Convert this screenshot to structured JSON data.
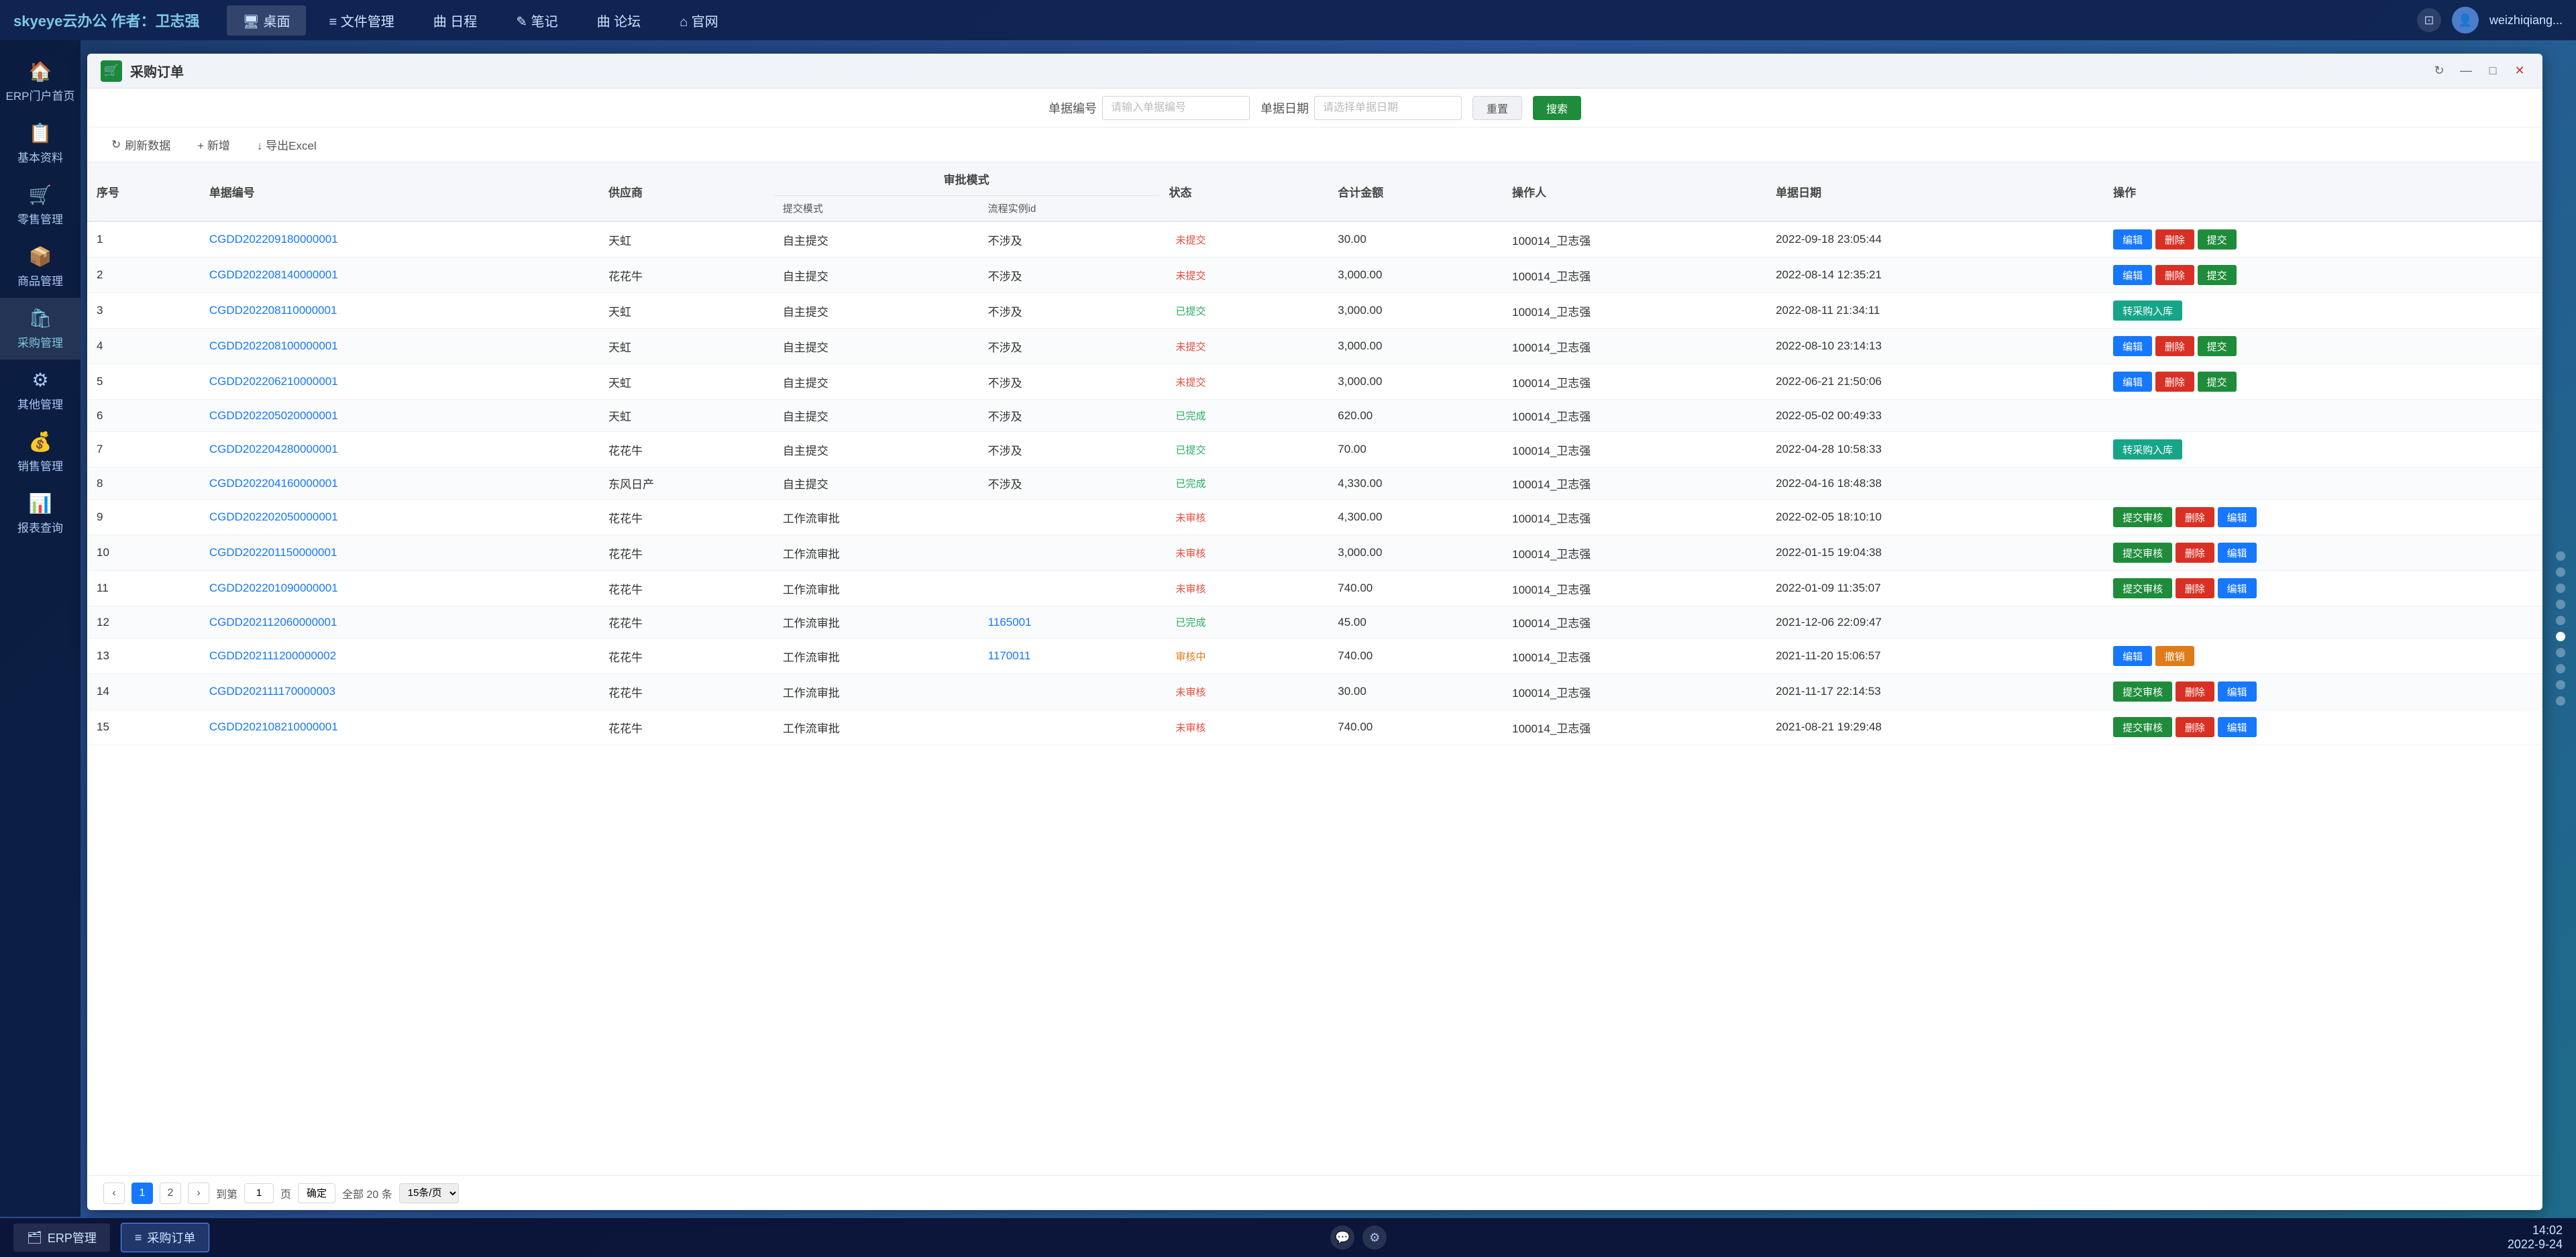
{
  "app": {
    "brand": "skyeye云办公 作者：卫志强",
    "nav_items": [
      {
        "label": "🖥 桌面",
        "active": true
      },
      {
        "label": "≡ 文件管理",
        "active": false
      },
      {
        "label": "曲 日程",
        "active": false
      },
      {
        "label": "✎ 笔记",
        "active": false
      },
      {
        "label": "曲 论坛",
        "active": false
      },
      {
        "label": "⌂ 官网",
        "active": false
      }
    ],
    "user": "weizhiqiang...",
    "time": "14:02\n2022-9-24"
  },
  "sidebar": {
    "items": [
      {
        "label": "ERP门户首页",
        "icon": "🏠"
      },
      {
        "label": "基本资料",
        "icon": "📋"
      },
      {
        "label": "零售管理",
        "icon": "🛒"
      },
      {
        "label": "商品管理",
        "icon": "📦"
      },
      {
        "label": "采购管理",
        "icon": "🛍",
        "active": true
      },
      {
        "label": "其他管理",
        "icon": "⚙"
      },
      {
        "label": "销售管理",
        "icon": "💰"
      },
      {
        "label": "报表查询",
        "icon": "📊"
      }
    ]
  },
  "window": {
    "title": "采购订单",
    "title_icon": "🛒"
  },
  "search": {
    "order_no_label": "单据编号",
    "order_no_placeholder": "请输入单据编号",
    "order_date_label": "单据日期",
    "order_date_placeholder": "请选择单据日期",
    "reset_label": "重置",
    "search_label": "搜索"
  },
  "actions": {
    "refresh": "刷新数据",
    "add": "+ 新增",
    "export": "↓ 导出Excel"
  },
  "table": {
    "columns": {
      "seq": "序号",
      "order_no": "单据编号",
      "supplier": "供应商",
      "approval_mode": "审批模式",
      "submit_mode": "提交模式",
      "process_id": "流程实例id",
      "status": "状态",
      "total_amount": "合计金额",
      "operator": "操作人",
      "order_date": "单据日期",
      "actions": "操作"
    },
    "rows": [
      {
        "seq": 1,
        "order_no": "CGDD202209180000001",
        "supplier": "天虹",
        "submit_mode": "自主提交",
        "process_id": "不涉及",
        "status": "未提交",
        "status_type": "red",
        "total_amount": "30.00",
        "operator": "100014_卫志强",
        "order_date": "2022-09-18 23:05:44",
        "btns": [
          "编辑",
          "删除",
          "提交"
        ]
      },
      {
        "seq": 2,
        "order_no": "CGDD202208140000001",
        "supplier": "花花牛",
        "submit_mode": "自主提交",
        "process_id": "不涉及",
        "status": "未提交",
        "status_type": "red",
        "total_amount": "3,000.00",
        "operator": "100014_卫志强",
        "order_date": "2022-08-14 12:35:21",
        "btns": [
          "编辑",
          "删除",
          "提交"
        ]
      },
      {
        "seq": 3,
        "order_no": "CGDD202208110000001",
        "supplier": "天虹",
        "submit_mode": "自主提交",
        "process_id": "不涉及",
        "status": "已提交",
        "status_type": "green",
        "total_amount": "3,000.00",
        "operator": "100014_卫志强",
        "order_date": "2022-08-11 21:34:11",
        "btns": [
          "转采购入库"
        ]
      },
      {
        "seq": 4,
        "order_no": "CGDD202208100000001",
        "supplier": "天虹",
        "submit_mode": "自主提交",
        "process_id": "不涉及",
        "status": "未提交",
        "status_type": "red",
        "total_amount": "3,000.00",
        "operator": "100014_卫志强",
        "order_date": "2022-08-10 23:14:13",
        "btns": [
          "编辑",
          "删除",
          "提交"
        ]
      },
      {
        "seq": 5,
        "order_no": "CGDD202206210000001",
        "supplier": "天虹",
        "submit_mode": "自主提交",
        "process_id": "不涉及",
        "status": "未提交",
        "status_type": "red",
        "total_amount": "3,000.00",
        "operator": "100014_卫志强",
        "order_date": "2022-06-21 21:50:06",
        "btns": [
          "编辑",
          "删除",
          "提交"
        ]
      },
      {
        "seq": 6,
        "order_no": "CGDD202205020000001",
        "supplier": "天虹",
        "submit_mode": "自主提交",
        "process_id": "不涉及",
        "status": "已完成",
        "status_type": "green",
        "total_amount": "620.00",
        "operator": "100014_卫志强",
        "order_date": "2022-05-02 00:49:33",
        "btns": []
      },
      {
        "seq": 7,
        "order_no": "CGDD202204280000001",
        "supplier": "花花牛",
        "submit_mode": "自主提交",
        "process_id": "不涉及",
        "status": "已提交",
        "status_type": "green",
        "total_amount": "70.00",
        "operator": "100014_卫志强",
        "order_date": "2022-04-28 10:58:33",
        "btns": [
          "转采购入库"
        ]
      },
      {
        "seq": 8,
        "order_no": "CGDD202204160000001",
        "supplier": "东风日产",
        "submit_mode": "自主提交",
        "process_id": "不涉及",
        "status": "已完成",
        "status_type": "green",
        "total_amount": "4,330.00",
        "operator": "100014_卫志强",
        "order_date": "2022-04-16 18:48:38",
        "btns": []
      },
      {
        "seq": 9,
        "order_no": "CGDD202202050000001",
        "supplier": "花花牛",
        "submit_mode": "工作流审批",
        "process_id": "",
        "status": "未审核",
        "status_type": "red",
        "total_amount": "4,300.00",
        "operator": "100014_卫志强",
        "order_date": "2022-02-05 18:10:10",
        "btns": [
          "提交审核",
          "删除",
          "编辑"
        ]
      },
      {
        "seq": 10,
        "order_no": "CGDD202201150000001",
        "supplier": "花花牛",
        "submit_mode": "工作流审批",
        "process_id": "",
        "status": "未审核",
        "status_type": "red",
        "total_amount": "3,000.00",
        "operator": "100014_卫志强",
        "order_date": "2022-01-15 19:04:38",
        "btns": [
          "提交审核",
          "删除",
          "编辑"
        ]
      },
      {
        "seq": 11,
        "order_no": "CGDD202201090000001",
        "supplier": "花花牛",
        "submit_mode": "工作流审批",
        "process_id": "",
        "status": "未审核",
        "status_type": "red",
        "total_amount": "740.00",
        "operator": "100014_卫志强",
        "order_date": "2022-01-09 11:35:07",
        "btns": [
          "提交审核",
          "删除",
          "编辑"
        ]
      },
      {
        "seq": 12,
        "order_no": "CGDD202112060000001",
        "supplier": "花花牛",
        "submit_mode": "工作流审批",
        "process_id": "1165001",
        "process_id_link": true,
        "status": "已完成",
        "status_type": "green",
        "total_amount": "45.00",
        "operator": "100014_卫志强",
        "order_date": "2021-12-06 22:09:47",
        "btns": []
      },
      {
        "seq": 13,
        "order_no": "CGDD202111200000002",
        "supplier": "花花牛",
        "submit_mode": "工作流审批",
        "process_id": "1170011",
        "process_id_link": true,
        "status": "审核中",
        "status_type": "orange",
        "total_amount": "740.00",
        "operator": "100014_卫志强",
        "order_date": "2021-11-20 15:06:57",
        "btns": [
          "编辑",
          "撤销"
        ]
      },
      {
        "seq": 14,
        "order_no": "CGDD202111170000003",
        "supplier": "花花牛",
        "submit_mode": "工作流审批",
        "process_id": "",
        "status": "未审核",
        "status_type": "red",
        "total_amount": "30.00",
        "operator": "100014_卫志强",
        "order_date": "2021-11-17 22:14:53",
        "btns": [
          "提交审核",
          "删除",
          "编辑"
        ]
      },
      {
        "seq": 15,
        "order_no": "CGDD202108210000001",
        "supplier": "花花牛",
        "submit_mode": "工作流审批",
        "process_id": "",
        "status": "未审核",
        "status_type": "red",
        "total_amount": "740.00",
        "operator": "100014_卫志强",
        "order_date": "2021-08-21 19:29:48",
        "btns": [
          "提交审核",
          "删除",
          "编辑"
        ]
      }
    ]
  },
  "pagination": {
    "current_page": 1,
    "total_pages": 2,
    "total_records": "全部 20 条",
    "page_size": "15条/页",
    "goto_label": "到第",
    "page_unit": "页",
    "confirm_label": "确定"
  },
  "taskbar": {
    "items": [
      {
        "label": "ERP管理",
        "icon": "🗂"
      },
      {
        "label": "采购订单",
        "icon": "≡",
        "active": true
      }
    ],
    "time_line1": "14:02",
    "time_line2": "2022-9-24"
  }
}
